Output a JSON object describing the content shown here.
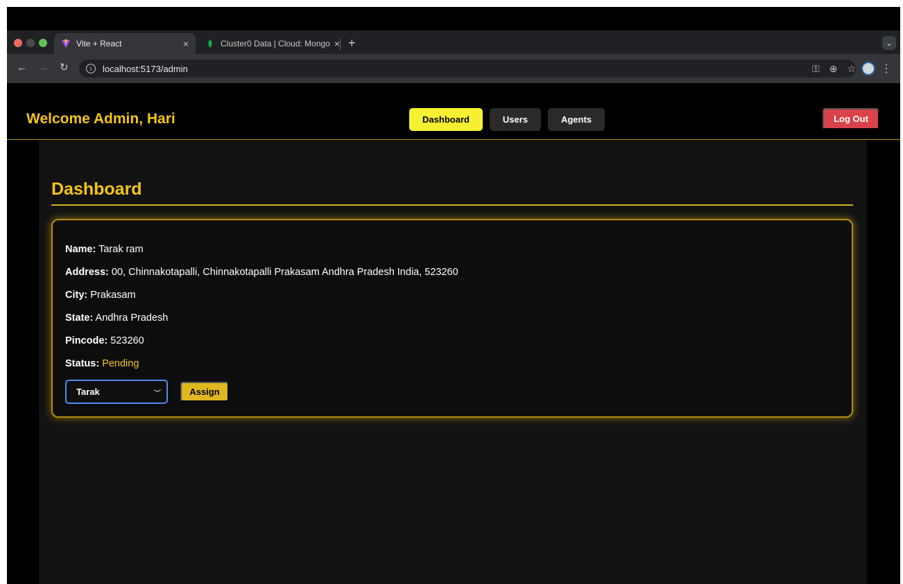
{
  "browser": {
    "tabs": [
      {
        "title": "Vite + React",
        "active": true
      },
      {
        "title": "Cluster0 Data | Cloud: Mongo",
        "active": false
      }
    ],
    "url": "localhost:5173/admin",
    "new_tab_symbol": "+",
    "close_symbol": "×",
    "icons": [
      "back-icon",
      "forward-icon",
      "reload-icon",
      "info-icon",
      "key-icon",
      "zoom-icon",
      "star-icon",
      "profile-avatar",
      "menu-icon"
    ]
  },
  "app": {
    "welcome": "Welcome Admin, Hari",
    "nav": {
      "dashboard": "Dashboard",
      "users": "Users",
      "agents": "Agents"
    },
    "logout": "Log Out",
    "page_title": "Dashboard",
    "complaint": {
      "name_label": "Name:",
      "name": "Tarak ram",
      "address_label": "Address:",
      "address": "00, Chinnakotapalli, Chinnakotapalli Prakasam Andhra Pradesh India, 523260",
      "city_label": "City:",
      "city": "Prakasam",
      "state_label": "State:",
      "state": "Andhra Pradesh",
      "pincode_label": "Pincode:",
      "pincode": "523260",
      "status_label": "Status:",
      "status": "Pending"
    },
    "agent_select_value": "Tarak",
    "assign_label": "Assign"
  },
  "colors": {
    "accent": "#f5c518",
    "active_nav": "#f7f031",
    "logout": "#d9424a",
    "select_border": "#4d8ef0"
  }
}
